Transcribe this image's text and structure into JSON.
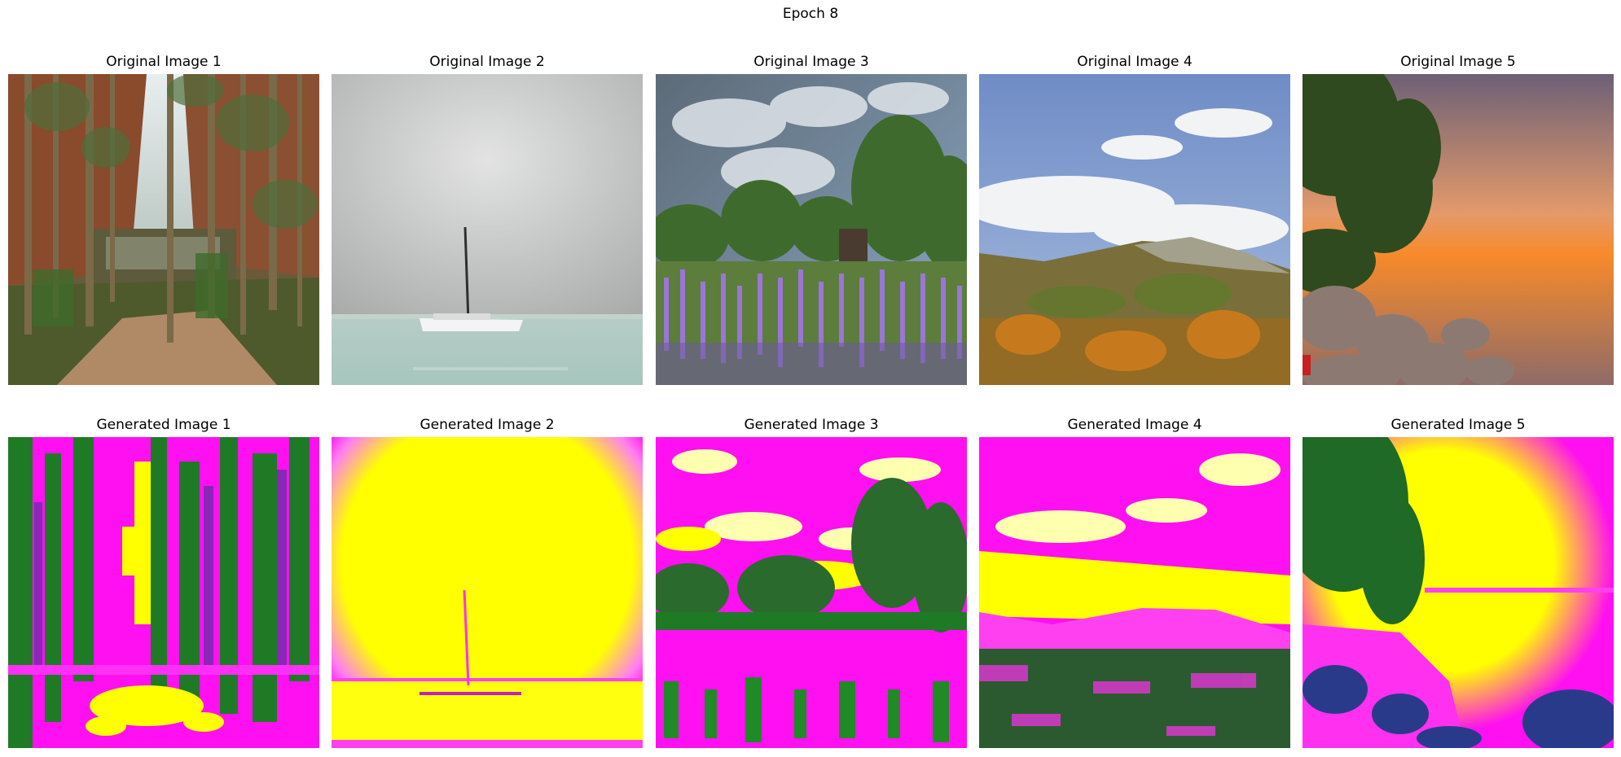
{
  "figure": {
    "title": "Epoch 8"
  },
  "panels": {
    "original": [
      {
        "title": "Original Image 1",
        "scene": "forest-path"
      },
      {
        "title": "Original Image 2",
        "scene": "sailboat-sea"
      },
      {
        "title": "Original Image 3",
        "scene": "lavender-field"
      },
      {
        "title": "Original Image 4",
        "scene": "mountain-autumn"
      },
      {
        "title": "Original Image 5",
        "scene": "sunset-rocks"
      }
    ],
    "generated": [
      {
        "title": "Generated Image 1",
        "scene": "forest-path"
      },
      {
        "title": "Generated Image 2",
        "scene": "sailboat-sea"
      },
      {
        "title": "Generated Image 3",
        "scene": "lavender-field"
      },
      {
        "title": "Generated Image 4",
        "scene": "mountain-autumn"
      },
      {
        "title": "Generated Image 5",
        "scene": "sunset-rocks"
      }
    ]
  },
  "palette": {
    "magenta": "#ff00ff",
    "yellow": "#ffff00",
    "green": "#1a7a22"
  }
}
